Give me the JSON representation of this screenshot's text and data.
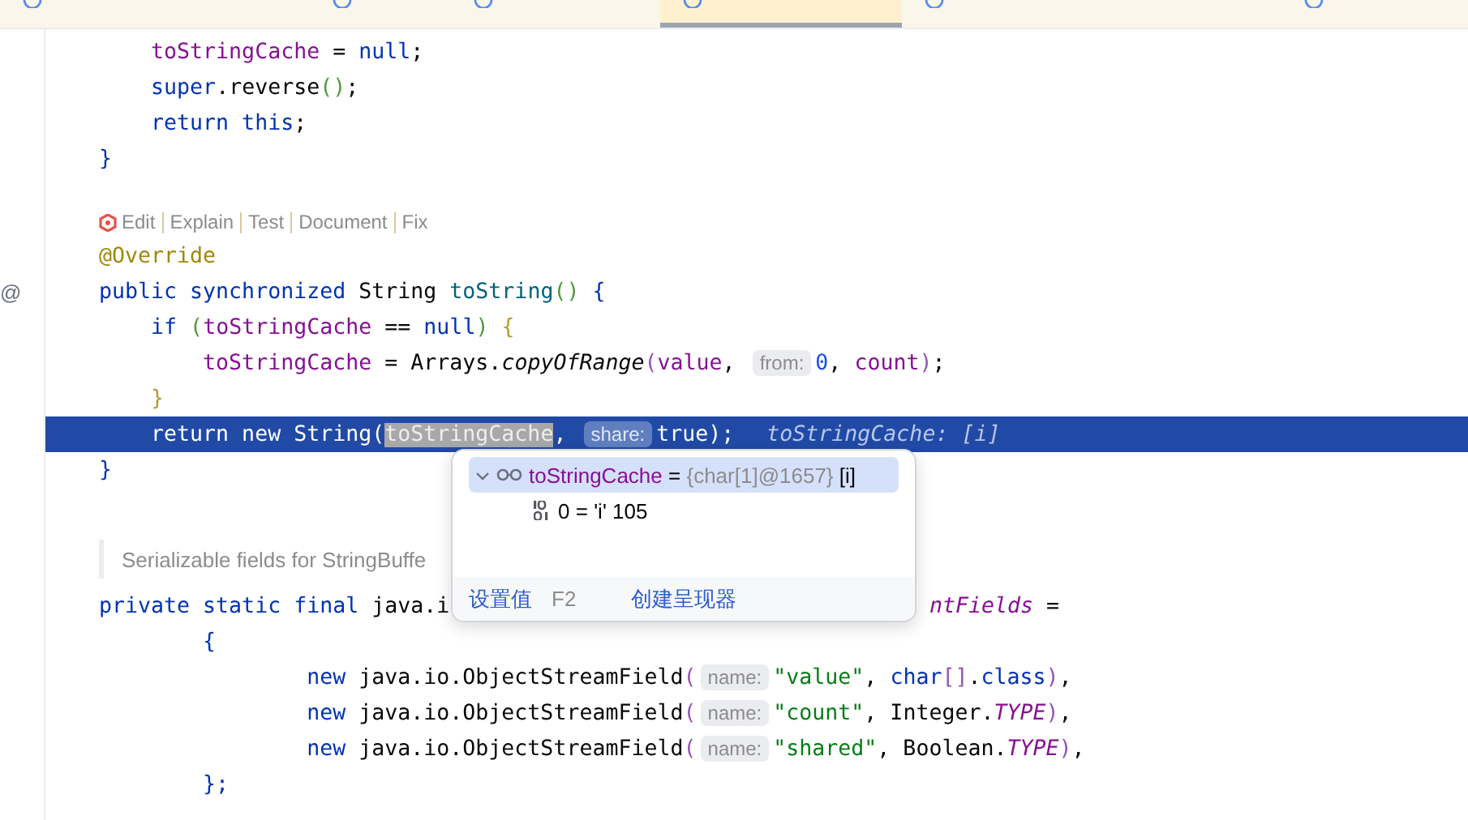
{
  "tabs": [
    {
      "selected": false
    },
    {
      "selected": false
    },
    {
      "selected": false
    },
    {
      "selected": true
    },
    {
      "selected": false
    },
    {
      "selected": false
    }
  ],
  "lines": [
    {
      "kind": "code",
      "current": false,
      "tokens": [
        {
          "t": "    toStringCache",
          "kind": "field"
        },
        {
          "t": " = "
        },
        {
          "t": "null",
          "kind": "keyword"
        },
        {
          "t": ";"
        }
      ]
    },
    {
      "kind": "code",
      "current": false,
      "tokens": [
        {
          "t": "    super",
          "kind": "keyword"
        },
        {
          "t": ".reverse"
        },
        {
          "t": "()",
          "kind": "bracket2"
        },
        {
          "t": ";"
        }
      ]
    },
    {
      "kind": "code",
      "current": false,
      "tokens": [
        {
          "t": "    return this",
          "kind": "keyword"
        },
        {
          "t": ";"
        }
      ]
    },
    {
      "kind": "code",
      "current": false,
      "tokens": [
        {
          "t": "}",
          "kind": "keyword"
        }
      ]
    },
    {
      "kind": "blank"
    },
    {
      "kind": "actions",
      "items": [
        "Edit",
        "Explain",
        "Test",
        "Document",
        "Fix"
      ]
    },
    {
      "kind": "code",
      "current": false,
      "tokens": [
        {
          "t": "@Override",
          "kind": "annotation"
        }
      ]
    },
    {
      "kind": "code",
      "current": false,
      "gutter_marker": "@",
      "tokens": [
        {
          "t": "public synchronized ",
          "kind": "keyword"
        },
        {
          "t": "String "
        },
        {
          "t": "toString",
          "kind": "method"
        },
        {
          "t": "()",
          "kind": "bracket2"
        },
        {
          "t": " {",
          "kind": "keyword"
        }
      ]
    },
    {
      "kind": "code",
      "current": false,
      "tokens": [
        {
          "t": "    if ",
          "kind": "keyword"
        },
        {
          "t": "(",
          "kind": "bracket2"
        },
        {
          "t": "toStringCache",
          "kind": "field"
        },
        {
          "t": " == "
        },
        {
          "t": "null",
          "kind": "keyword"
        },
        {
          "t": ")",
          "kind": "bracket2"
        },
        {
          "t": " {",
          "kind": "bracket1"
        }
      ]
    },
    {
      "kind": "code",
      "current": false,
      "tokens": [
        {
          "t": "        toStringCache",
          "kind": "field"
        },
        {
          "t": " = Arrays."
        },
        {
          "t": "copyOfRange",
          "kind": "italic"
        },
        {
          "t": "(",
          "kind": "bracket3"
        },
        {
          "t": "value",
          "kind": "field"
        },
        {
          "t": ", "
        },
        {
          "t": "from:",
          "kind": "hint"
        },
        {
          "t": "0",
          "kind": "number"
        },
        {
          "t": ", "
        },
        {
          "t": "count",
          "kind": "field"
        },
        {
          "t": ")",
          "kind": "bracket3"
        },
        {
          "t": ";"
        }
      ]
    },
    {
      "kind": "code",
      "current": false,
      "tokens": [
        {
          "t": "    }",
          "kind": "bracket1"
        }
      ]
    },
    {
      "kind": "code",
      "current": true,
      "tokens": [
        {
          "t": "    return new String("
        },
        {
          "t": "toStringCache",
          "kind": "selection"
        },
        {
          "t": ", "
        },
        {
          "t": "share:",
          "kind": "hint"
        },
        {
          "t": "true);"
        },
        {
          "t": "toStringCache: [i]",
          "kind": "debug"
        }
      ]
    },
    {
      "kind": "code",
      "current": false,
      "tokens": [
        {
          "t": "}",
          "kind": "keyword"
        }
      ]
    },
    {
      "kind": "blank"
    },
    {
      "kind": "doc",
      "text": "Serializable fields for StringBuffe"
    },
    {
      "kind": "code",
      "current": false,
      "tokens": [
        {
          "t": "private static final ",
          "kind": "keyword"
        },
        {
          "t": "java.i"
        }
      ],
      "after_popup": [
        {
          "t": "ntFields",
          "kind": "constant"
        },
        {
          "t": " ="
        }
      ]
    },
    {
      "kind": "code",
      "current": false,
      "tokens": [
        {
          "t": "        {",
          "kind": "keyword"
        }
      ]
    },
    {
      "kind": "code",
      "current": false,
      "tokens": [
        {
          "t": "                new ",
          "kind": "keyword"
        },
        {
          "t": "java.io.ObjectStreamField"
        },
        {
          "t": "(",
          "kind": "bracket3"
        },
        {
          "t": "name:",
          "kind": "hint"
        },
        {
          "t": "\"value\"",
          "kind": "string"
        },
        {
          "t": ", "
        },
        {
          "t": "char",
          "kind": "keyword"
        },
        {
          "t": "[]",
          "kind": "bracket3"
        },
        {
          "t": "."
        },
        {
          "t": "class",
          "kind": "keyword"
        },
        {
          "t": ")",
          "kind": "bracket3"
        },
        {
          "t": ","
        }
      ]
    },
    {
      "kind": "code",
      "current": false,
      "tokens": [
        {
          "t": "                new ",
          "kind": "keyword"
        },
        {
          "t": "java.io.ObjectStreamField"
        },
        {
          "t": "(",
          "kind": "bracket3"
        },
        {
          "t": "name:",
          "kind": "hint"
        },
        {
          "t": "\"count\"",
          "kind": "string"
        },
        {
          "t": ", Integer."
        },
        {
          "t": "TYPE",
          "kind": "constant"
        },
        {
          "t": ")",
          "kind": "bracket3"
        },
        {
          "t": ","
        }
      ]
    },
    {
      "kind": "code",
      "current": false,
      "tokens": [
        {
          "t": "                new ",
          "kind": "keyword"
        },
        {
          "t": "java.io.ObjectStreamField"
        },
        {
          "t": "(",
          "kind": "bracket3"
        },
        {
          "t": "name:",
          "kind": "hint"
        },
        {
          "t": "\"shared\"",
          "kind": "string"
        },
        {
          "t": ", Boolean."
        },
        {
          "t": "TYPE",
          "kind": "constant"
        },
        {
          "t": ")",
          "kind": "bracket3"
        },
        {
          "t": ","
        }
      ]
    },
    {
      "kind": "code",
      "current": false,
      "tokens": [
        {
          "t": "        };",
          "kind": "keyword"
        }
      ]
    }
  ],
  "popup": {
    "rows": [
      {
        "kind": "array",
        "selected": true,
        "expanded": true,
        "name": "toStringCache",
        "eq": "=",
        "type": "{char[1]@1657}",
        "value": "[i]"
      },
      {
        "kind": "element",
        "selected": false,
        "name": "0",
        "eq": "=",
        "value": "'i' 105"
      }
    ],
    "footer": [
      {
        "kind": "link",
        "label": "设置值"
      },
      {
        "kind": "shortcut",
        "label": "F2"
      },
      {
        "kind": "link",
        "label": "创建呈现器"
      }
    ]
  }
}
